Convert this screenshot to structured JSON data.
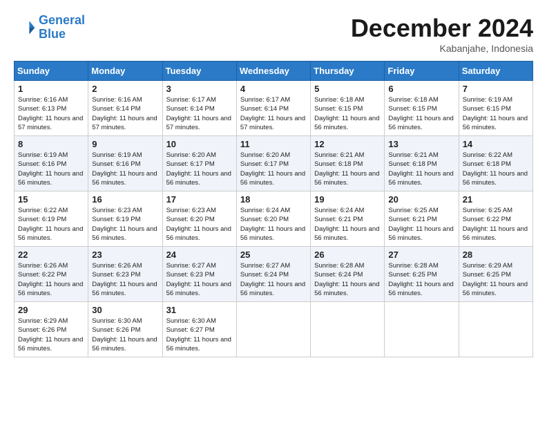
{
  "header": {
    "logo_line1": "General",
    "logo_line2": "Blue",
    "month_title": "December 2024",
    "location": "Kabanjahe, Indonesia"
  },
  "days_of_week": [
    "Sunday",
    "Monday",
    "Tuesday",
    "Wednesday",
    "Thursday",
    "Friday",
    "Saturday"
  ],
  "weeks": [
    [
      {
        "day": "1",
        "sunrise": "6:16 AM",
        "sunset": "6:13 PM",
        "daylight": "11 hours and 57 minutes."
      },
      {
        "day": "2",
        "sunrise": "6:16 AM",
        "sunset": "6:14 PM",
        "daylight": "11 hours and 57 minutes."
      },
      {
        "day": "3",
        "sunrise": "6:17 AM",
        "sunset": "6:14 PM",
        "daylight": "11 hours and 57 minutes."
      },
      {
        "day": "4",
        "sunrise": "6:17 AM",
        "sunset": "6:14 PM",
        "daylight": "11 hours and 57 minutes."
      },
      {
        "day": "5",
        "sunrise": "6:18 AM",
        "sunset": "6:15 PM",
        "daylight": "11 hours and 56 minutes."
      },
      {
        "day": "6",
        "sunrise": "6:18 AM",
        "sunset": "6:15 PM",
        "daylight": "11 hours and 56 minutes."
      },
      {
        "day": "7",
        "sunrise": "6:19 AM",
        "sunset": "6:15 PM",
        "daylight": "11 hours and 56 minutes."
      }
    ],
    [
      {
        "day": "8",
        "sunrise": "6:19 AM",
        "sunset": "6:16 PM",
        "daylight": "11 hours and 56 minutes."
      },
      {
        "day": "9",
        "sunrise": "6:19 AM",
        "sunset": "6:16 PM",
        "daylight": "11 hours and 56 minutes."
      },
      {
        "day": "10",
        "sunrise": "6:20 AM",
        "sunset": "6:17 PM",
        "daylight": "11 hours and 56 minutes."
      },
      {
        "day": "11",
        "sunrise": "6:20 AM",
        "sunset": "6:17 PM",
        "daylight": "11 hours and 56 minutes."
      },
      {
        "day": "12",
        "sunrise": "6:21 AM",
        "sunset": "6:18 PM",
        "daylight": "11 hours and 56 minutes."
      },
      {
        "day": "13",
        "sunrise": "6:21 AM",
        "sunset": "6:18 PM",
        "daylight": "11 hours and 56 minutes."
      },
      {
        "day": "14",
        "sunrise": "6:22 AM",
        "sunset": "6:18 PM",
        "daylight": "11 hours and 56 minutes."
      }
    ],
    [
      {
        "day": "15",
        "sunrise": "6:22 AM",
        "sunset": "6:19 PM",
        "daylight": "11 hours and 56 minutes."
      },
      {
        "day": "16",
        "sunrise": "6:23 AM",
        "sunset": "6:19 PM",
        "daylight": "11 hours and 56 minutes."
      },
      {
        "day": "17",
        "sunrise": "6:23 AM",
        "sunset": "6:20 PM",
        "daylight": "11 hours and 56 minutes."
      },
      {
        "day": "18",
        "sunrise": "6:24 AM",
        "sunset": "6:20 PM",
        "daylight": "11 hours and 56 minutes."
      },
      {
        "day": "19",
        "sunrise": "6:24 AM",
        "sunset": "6:21 PM",
        "daylight": "11 hours and 56 minutes."
      },
      {
        "day": "20",
        "sunrise": "6:25 AM",
        "sunset": "6:21 PM",
        "daylight": "11 hours and 56 minutes."
      },
      {
        "day": "21",
        "sunrise": "6:25 AM",
        "sunset": "6:22 PM",
        "daylight": "11 hours and 56 minutes."
      }
    ],
    [
      {
        "day": "22",
        "sunrise": "6:26 AM",
        "sunset": "6:22 PM",
        "daylight": "11 hours and 56 minutes."
      },
      {
        "day": "23",
        "sunrise": "6:26 AM",
        "sunset": "6:23 PM",
        "daylight": "11 hours and 56 minutes."
      },
      {
        "day": "24",
        "sunrise": "6:27 AM",
        "sunset": "6:23 PM",
        "daylight": "11 hours and 56 minutes."
      },
      {
        "day": "25",
        "sunrise": "6:27 AM",
        "sunset": "6:24 PM",
        "daylight": "11 hours and 56 minutes."
      },
      {
        "day": "26",
        "sunrise": "6:28 AM",
        "sunset": "6:24 PM",
        "daylight": "11 hours and 56 minutes."
      },
      {
        "day": "27",
        "sunrise": "6:28 AM",
        "sunset": "6:25 PM",
        "daylight": "11 hours and 56 minutes."
      },
      {
        "day": "28",
        "sunrise": "6:29 AM",
        "sunset": "6:25 PM",
        "daylight": "11 hours and 56 minutes."
      }
    ],
    [
      {
        "day": "29",
        "sunrise": "6:29 AM",
        "sunset": "6:26 PM",
        "daylight": "11 hours and 56 minutes."
      },
      {
        "day": "30",
        "sunrise": "6:30 AM",
        "sunset": "6:26 PM",
        "daylight": "11 hours and 56 minutes."
      },
      {
        "day": "31",
        "sunrise": "6:30 AM",
        "sunset": "6:27 PM",
        "daylight": "11 hours and 56 minutes."
      },
      null,
      null,
      null,
      null
    ]
  ]
}
